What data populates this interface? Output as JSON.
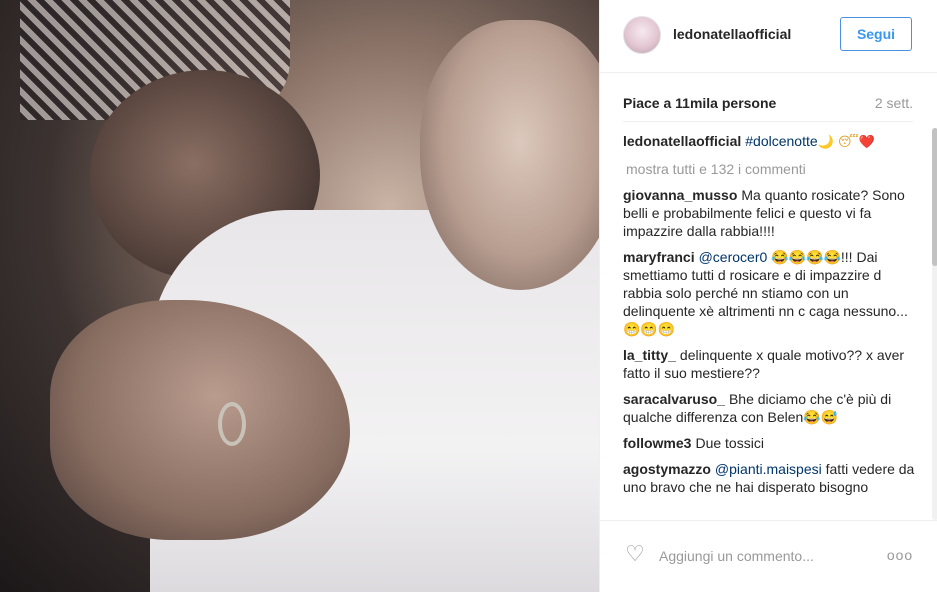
{
  "post": {
    "username": "ledonatellaofficial",
    "follow_label": "Segui",
    "likes_text": "Piace a 11mila persone",
    "time_ago": "2 sett.",
    "caption": {
      "user": "ledonatellaofficial",
      "hashtag": "#dolcenotte",
      "emoji": "🌙 😴❤️"
    },
    "show_all": "mostra tutti e 132 i commenti"
  },
  "comments": [
    {
      "user": "giovanna_musso",
      "pre": "",
      "mention": "",
      "text": "Ma quanto rosicate? Sono belli e probabilmente felici e questo vi fa impazzire dalla rabbia!!!!",
      "emoji": ""
    },
    {
      "user": "maryfranci",
      "pre": "",
      "mention": "@cerocer0",
      "text": " 😂😂😂😂!!! Dai smettiamo tutti d rosicare e di impazzire d rabbia solo perché nn stiamo con un delinquente xè altrimenti nn c caga nessuno... 😁😁😁",
      "emoji": ""
    },
    {
      "user": "la_titty_",
      "pre": "",
      "mention": "",
      "text": "delinquente x quale motivo?? x aver fatto il suo mestiere??",
      "emoji": ""
    },
    {
      "user": "saracalvaruso_",
      "pre": "",
      "mention": "",
      "text": "Bhe diciamo che c'è più di qualche differenza con Belen😂😅",
      "emoji": ""
    },
    {
      "user": "followme3",
      "pre": "",
      "mention": "",
      "text": "Due tossici",
      "emoji": ""
    },
    {
      "user": "agostymazzo",
      "pre": "",
      "mention": "@pianti.maispesi",
      "text": " fatti vedere da uno bravo che ne hai disperato bisogno",
      "emoji": ""
    }
  ],
  "footer": {
    "comment_placeholder": "Aggiungi un commento...",
    "more_label": "ooo"
  },
  "colors": {
    "accent_blue": "#3897f0",
    "follow_border": "#4a90e2",
    "text": "#262626",
    "muted": "#999999",
    "link": "#003569"
  },
  "icons": {
    "like": "heart-outline-icon",
    "more": "more-options-icon"
  }
}
